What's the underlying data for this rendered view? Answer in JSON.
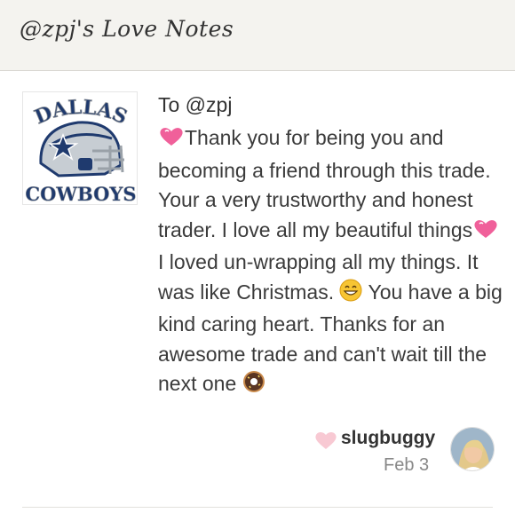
{
  "header": {
    "title": "@zpj's Love Notes"
  },
  "note": {
    "logo": {
      "top_text": "DALLAS",
      "bottom_text": "COWBOYS"
    },
    "recipient": "To @zpj",
    "message_parts": [
      "Thank you for being you and becoming a friend through this trade. Your a very trustworthy and honest trader. I love all my beautiful things",
      " I loved un-wrapping all my things. It was like Christmas. ",
      " You have a big kind caring heart. Thanks for an awesome trade and can't wait till the next one "
    ],
    "emojis": [
      "sparkling-heart",
      "sparkling-heart",
      "grinning-face",
      "donut"
    ],
    "sender": {
      "name": "slugbuggy",
      "date": "Feb 3"
    },
    "colors": {
      "heart": "#f0609a",
      "like_heart": "#f8c9d3",
      "cowboys_blue": "#1f3a6e"
    }
  }
}
